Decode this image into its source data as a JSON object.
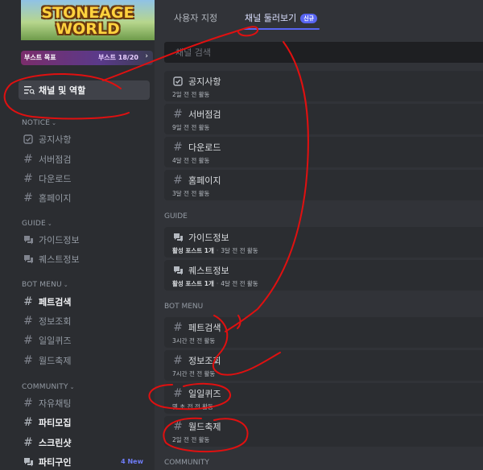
{
  "server": {
    "banner_lines": [
      "STONEAGE",
      "WORLD"
    ],
    "boost": {
      "label": "부스트 목표",
      "count": "부스트 18/20",
      "chevron": "›"
    },
    "channels_roles_label": "채널 및 역할"
  },
  "sidebar": {
    "categories": [
      {
        "name": "NOTICE",
        "chevron": "⌄"
      },
      {
        "name": "GUIDE",
        "chevron": "⌄"
      },
      {
        "name": "BOT MENU",
        "chevron": "⌄"
      },
      {
        "name": "COMMUNITY",
        "chevron": "⌄"
      }
    ],
    "notice": [
      {
        "name": "공지사항",
        "icon": "announcement-icon"
      },
      {
        "name": "서버점검",
        "icon": "hash-icon"
      },
      {
        "name": "다운로드",
        "icon": "hash-icon"
      },
      {
        "name": "홈페이지",
        "icon": "hash-icon"
      }
    ],
    "guide": [
      {
        "name": "가이드정보",
        "icon": "forum-icon"
      },
      {
        "name": "퀘스트정보",
        "icon": "forum-icon"
      }
    ],
    "bot_menu": [
      {
        "name": "페트검색",
        "icon": "hash-icon",
        "unread": true
      },
      {
        "name": "정보조회",
        "icon": "hash-icon"
      },
      {
        "name": "일일퀴즈",
        "icon": "hash-icon"
      },
      {
        "name": "월드축제",
        "icon": "hash-icon"
      }
    ],
    "community": [
      {
        "name": "자유채팅",
        "icon": "hash-icon"
      },
      {
        "name": "파티모집",
        "icon": "hash-icon",
        "unread": true
      },
      {
        "name": "스크린샷",
        "icon": "hash-icon",
        "unread": true
      },
      {
        "name": "파티구인",
        "icon": "forum-icon",
        "unread": true,
        "badge": "4 New"
      }
    ]
  },
  "tabs": [
    {
      "label": "사용자 지정"
    },
    {
      "label": "채널 둘러보기",
      "badge": "신규",
      "active": true
    }
  ],
  "search": {
    "placeholder": "채널 검색"
  },
  "browse": {
    "notice": [
      {
        "name": "공지사항",
        "icon": "announcement-icon",
        "activity": "2일 전 전 활동"
      },
      {
        "name": "서버점검",
        "icon": "hash-icon",
        "activity": "9일 전 전 활동"
      },
      {
        "name": "다운로드",
        "icon": "hash-icon",
        "activity": "4달 전 전 활동"
      },
      {
        "name": "홈페이지",
        "icon": "hash-icon",
        "activity": "3달 전 전 활동"
      }
    ],
    "guide_label": "GUIDE",
    "guide": [
      {
        "name": "가이드정보",
        "icon": "forum-icon",
        "posts": "활성 포스트 1개",
        "activity": "3달 전 전 활동"
      },
      {
        "name": "퀘스트정보",
        "icon": "forum-icon",
        "posts": "활성 포스트 1개",
        "activity": "4달 전 전 활동"
      }
    ],
    "bot_label": "BOT MENU",
    "bot": [
      {
        "name": "페트검색",
        "icon": "hash-icon",
        "activity": "3시간 전 전 활동"
      },
      {
        "name": "정보조회",
        "icon": "hash-icon",
        "activity": "7시간 전 전 활동"
      },
      {
        "name": "일일퀴즈",
        "icon": "hash-icon",
        "activity": "몇 초 전 전 활동"
      },
      {
        "name": "월드축제",
        "icon": "hash-icon",
        "activity": "2일 전 전 활동"
      }
    ],
    "community_label": "COMMUNITY"
  },
  "colors": {
    "accent": "#5865f2",
    "annotation": "#e01010",
    "sidebar_bg": "#2b2d31",
    "main_bg": "#313338"
  }
}
